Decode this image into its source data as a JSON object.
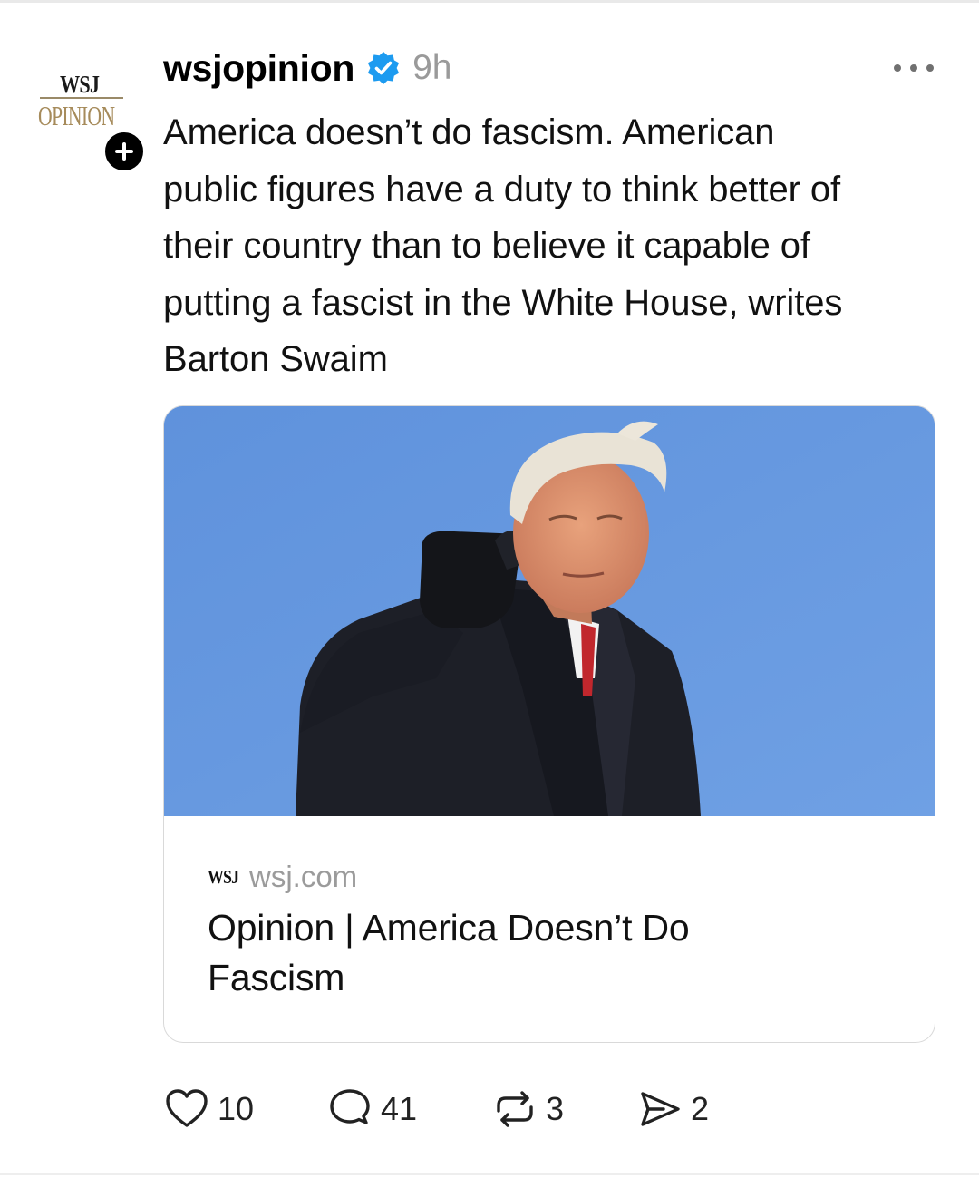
{
  "post": {
    "author": {
      "username": "wsjopinion",
      "avatar_logo_top": "WSJ",
      "avatar_logo_bottom": "OPINION",
      "verified_icon": "verified-badge-icon",
      "follow_icon": "plus-icon"
    },
    "timestamp": "9h",
    "more_icon": "more-options-icon",
    "text_lines": [
      "America doesn’t do fascism. American",
      "public figures have a duty to think better of",
      "their country than to believe it capable of",
      "putting a fascist in the White House, writes",
      "Barton Swaim"
    ],
    "link_card": {
      "image_icon": "article-photo",
      "source_logo": "WSJ",
      "domain": "wsj.com",
      "title_lines": [
        "Opinion | America Doesn’t Do",
        "Fascism"
      ]
    },
    "actions": {
      "like": {
        "icon": "heart-icon",
        "count": "10"
      },
      "reply": {
        "icon": "comment-icon",
        "count": "41"
      },
      "repost": {
        "icon": "repost-icon",
        "count": "3"
      },
      "share": {
        "icon": "send-icon",
        "count": "2"
      }
    }
  },
  "colors": {
    "verified": "#1d9bf0",
    "muted_text": "#9a9a9a",
    "sky": "#6d9be0",
    "opinion_gold": "#a68b5b"
  }
}
